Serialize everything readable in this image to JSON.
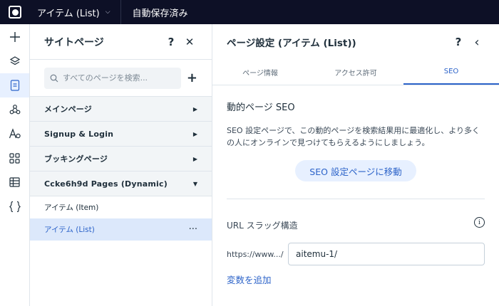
{
  "topbar": {
    "current_page": "アイテム (List)",
    "autosave_status": "自動保存済み"
  },
  "rail": {
    "items": [
      {
        "icon": "plus-icon"
      },
      {
        "icon": "layers-icon"
      },
      {
        "icon": "pages-icon",
        "active": true
      },
      {
        "icon": "nodes-icon"
      },
      {
        "icon": "theme-text-icon"
      },
      {
        "icon": "apps-grid-icon"
      },
      {
        "icon": "table-icon"
      },
      {
        "icon": "code-braces-icon"
      }
    ]
  },
  "site_pages": {
    "title": "サイトページ",
    "help_label": "?",
    "close_label": "✕",
    "search_placeholder": "すべてのページを検索...",
    "add_label": "+",
    "sections": [
      {
        "label": "メインページ"
      },
      {
        "label": "Signup & Login"
      },
      {
        "label": "ブッキングページ"
      },
      {
        "label": "Ccke6h9d Pages (Dynamic)",
        "expanded": true
      }
    ],
    "dynamic_pages": [
      {
        "label": "アイテム (Item)"
      },
      {
        "label": "アイテム (List)",
        "more": "···"
      }
    ]
  },
  "page_settings": {
    "title": "ページ設定 (アイテム (List))",
    "help_label": "?",
    "back_label": "‹",
    "tabs": [
      {
        "label": "ページ情報"
      },
      {
        "label": "アクセス許可"
      },
      {
        "label": "SEO",
        "active": true
      }
    ],
    "seo": {
      "heading": "動的ページ SEO",
      "description": "SEO 設定ページで、この動的ページを検索結果用に最適化し、より多くの人にオンラインで見つけてもらえるようにしましょう。",
      "button_label": "SEO 設定ページに移動"
    },
    "url_slug": {
      "label": "URL スラッグ構造",
      "info_label": "i",
      "prefix": "https://www.../",
      "value": "aitemu-1/",
      "add_variable_label": "変数を追加"
    }
  },
  "colors": {
    "topbar_bg": "#0d1026",
    "accent": "#2c63c9",
    "selected_bg": "#dce8fb",
    "section_bg": "#f2f5f7"
  }
}
